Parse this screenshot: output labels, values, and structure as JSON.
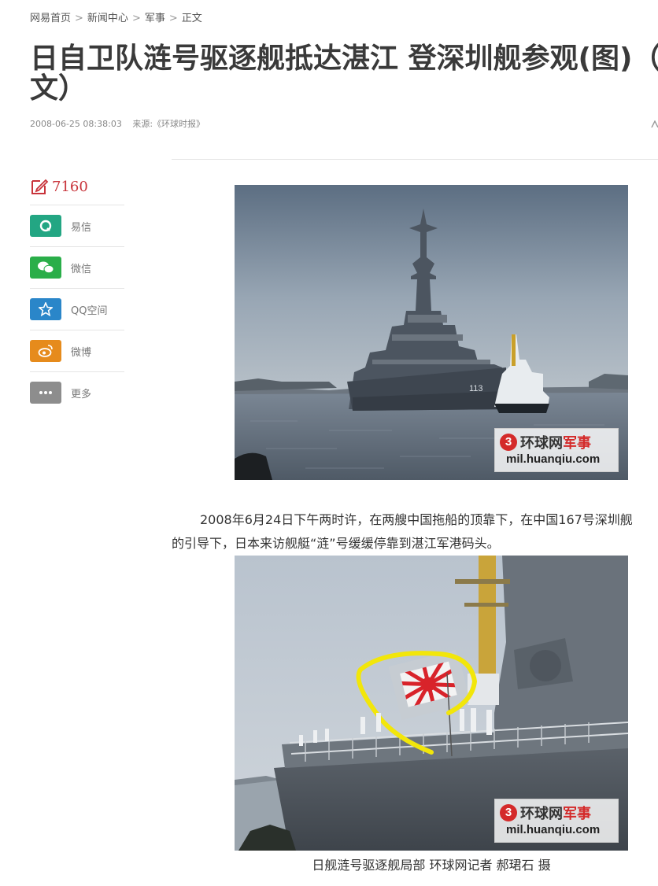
{
  "breadcrumb": {
    "home": "网易首页",
    "sep": ">",
    "news_center": "新闻中心",
    "military": "军事",
    "current": "正文"
  },
  "article": {
    "title": "日自卫队涟号驱逐舰抵达湛江 登深圳舰参观(图)（全文）",
    "published": "2008-06-25 08:38:03",
    "source_label": "来源:",
    "source": "《环球时报》",
    "paragraph_line1": "2008年6月24日下午两时许，在两艘中国拖船的顶靠下，在中国167号深圳舰",
    "paragraph_line2": "的引导下，日本来访舰艇“涟”号缓缓停靠到湛江军港码头。",
    "caption": "日舰涟号驱逐舰局部  环球网记者 郝珺石 摄"
  },
  "share": {
    "comment_count": "7160",
    "items": [
      {
        "label": "易信",
        "icon": "yixin-icon",
        "color": "#23a683"
      },
      {
        "label": "微信",
        "icon": "wechat-icon",
        "color": "#2aae49"
      },
      {
        "label": "QQ空间",
        "icon": "qzone-icon",
        "color": "#2a86c9"
      },
      {
        "label": "微博",
        "icon": "weibo-icon",
        "color": "#e68b1c"
      },
      {
        "label": "更多",
        "icon": "more-icon",
        "color": "#8d8d8d"
      }
    ]
  },
  "watermark": {
    "brand_plain": "环球网",
    "brand_red": "军事",
    "url": "mil.huanqiu.com",
    "logo_char": "3"
  },
  "photos": {
    "hull_number": "113"
  }
}
